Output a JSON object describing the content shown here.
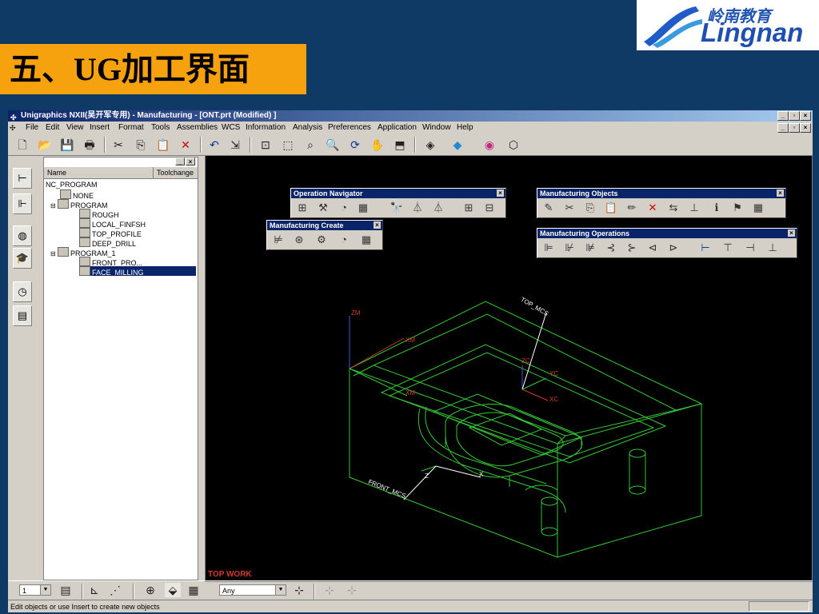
{
  "slide": {
    "title": "五、UG加工界面"
  },
  "logo": {
    "cn": "岭南教育",
    "en": "Lingnan"
  },
  "window": {
    "title": "Unigraphics NXII(吴开军专用) - Manufacturing - [ONT.prt (Modified) ]"
  },
  "menu": [
    "File",
    "Edit",
    "View",
    "Insert",
    "Format",
    "Tools",
    "Assemblies",
    "WCS",
    "Information",
    "Analysis",
    "Preferences",
    "Application",
    "Window",
    "Help"
  ],
  "navigator": {
    "columns": [
      "Name",
      "Toolchange"
    ],
    "items": [
      {
        "label": "NC_PROGRAM"
      },
      {
        "label": "NONE"
      },
      {
        "label": "PROGRAM"
      },
      {
        "label": "ROUGH"
      },
      {
        "label": "LOCAL_FINFSH"
      },
      {
        "label": "TOP_PROFILE"
      },
      {
        "label": "DEEP_DRILL"
      },
      {
        "label": "PROGRAM_1"
      },
      {
        "label": "FRONT_PRO..."
      },
      {
        "label": "FACE_MILLING"
      }
    ]
  },
  "toolboxes": {
    "op_nav": "Operation Navigator",
    "mfg_objects": "Manufacturing Objects",
    "mfg_create": "Manufacturing Create",
    "mfg_ops": "Manufacturing Operations"
  },
  "viewport": {
    "view_name": "TOP WORK",
    "labels": {
      "zm": "ZM",
      "xm1": "XM",
      "xm2": "XM",
      "zc": "ZC",
      "yc": "YC",
      "xc": "XC",
      "z": "Z",
      "x": "X",
      "top_mcs": "TOP_MCS",
      "front_mcs": "FRONT_MCS"
    }
  },
  "bottom": {
    "layer": "1",
    "filter": "Any"
  },
  "status": {
    "prompt": "Edit objects or use Insert to create new objects"
  },
  "colors": {
    "slide_bg": "#103a66",
    "title_bg": "#f6a10e",
    "wire": "#35c935",
    "label": "#d23a2a"
  }
}
